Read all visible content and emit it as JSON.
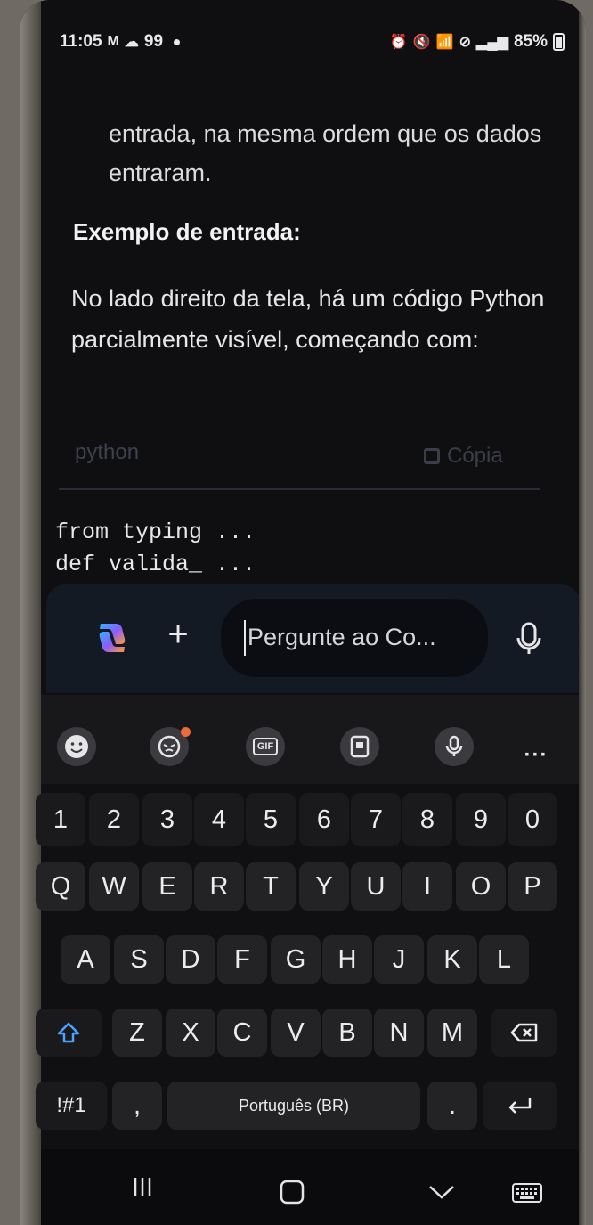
{
  "status_bar": {
    "time": "11:05",
    "notif_count": "99",
    "battery": "85%"
  },
  "chat": {
    "para_top": "entrada, na mesma ordem que os dados entraram.",
    "heading": "Exemplo de entrada:",
    "paragraph": "No lado direito da tela, há um código Python parcialmente visível, começando com:",
    "code_block": {
      "language": "python",
      "copy_label": "Cópia",
      "line1": "from typing ...",
      "line2": "def valida_ ..."
    }
  },
  "composer": {
    "placeholder": "Pergunte ao Co..."
  },
  "keyboard_toolbar": {
    "items": [
      "emoji-icon",
      "sticker-icon",
      "gif-icon",
      "clipboard-icon",
      "voice-input-icon",
      "more-icon"
    ],
    "gif_label": "GIF",
    "more_label": "···"
  },
  "keyboard": {
    "number_row": [
      "1",
      "2",
      "3",
      "4",
      "5",
      "6",
      "7",
      "8",
      "9",
      "0"
    ],
    "row1": [
      "Q",
      "W",
      "E",
      "R",
      "T",
      "Y",
      "U",
      "I",
      "O",
      "P"
    ],
    "row2": [
      "A",
      "S",
      "D",
      "F",
      "G",
      "H",
      "J",
      "K",
      "L"
    ],
    "row3": [
      "Z",
      "X",
      "C",
      "V",
      "B",
      "N",
      "M"
    ],
    "symbols_label": "!#1",
    "comma": ",",
    "space_label": "Português (BR)",
    "period": "."
  },
  "colors": {
    "accent_blue": "#4aa3ff",
    "notif_orange": "#ef6a3b"
  }
}
